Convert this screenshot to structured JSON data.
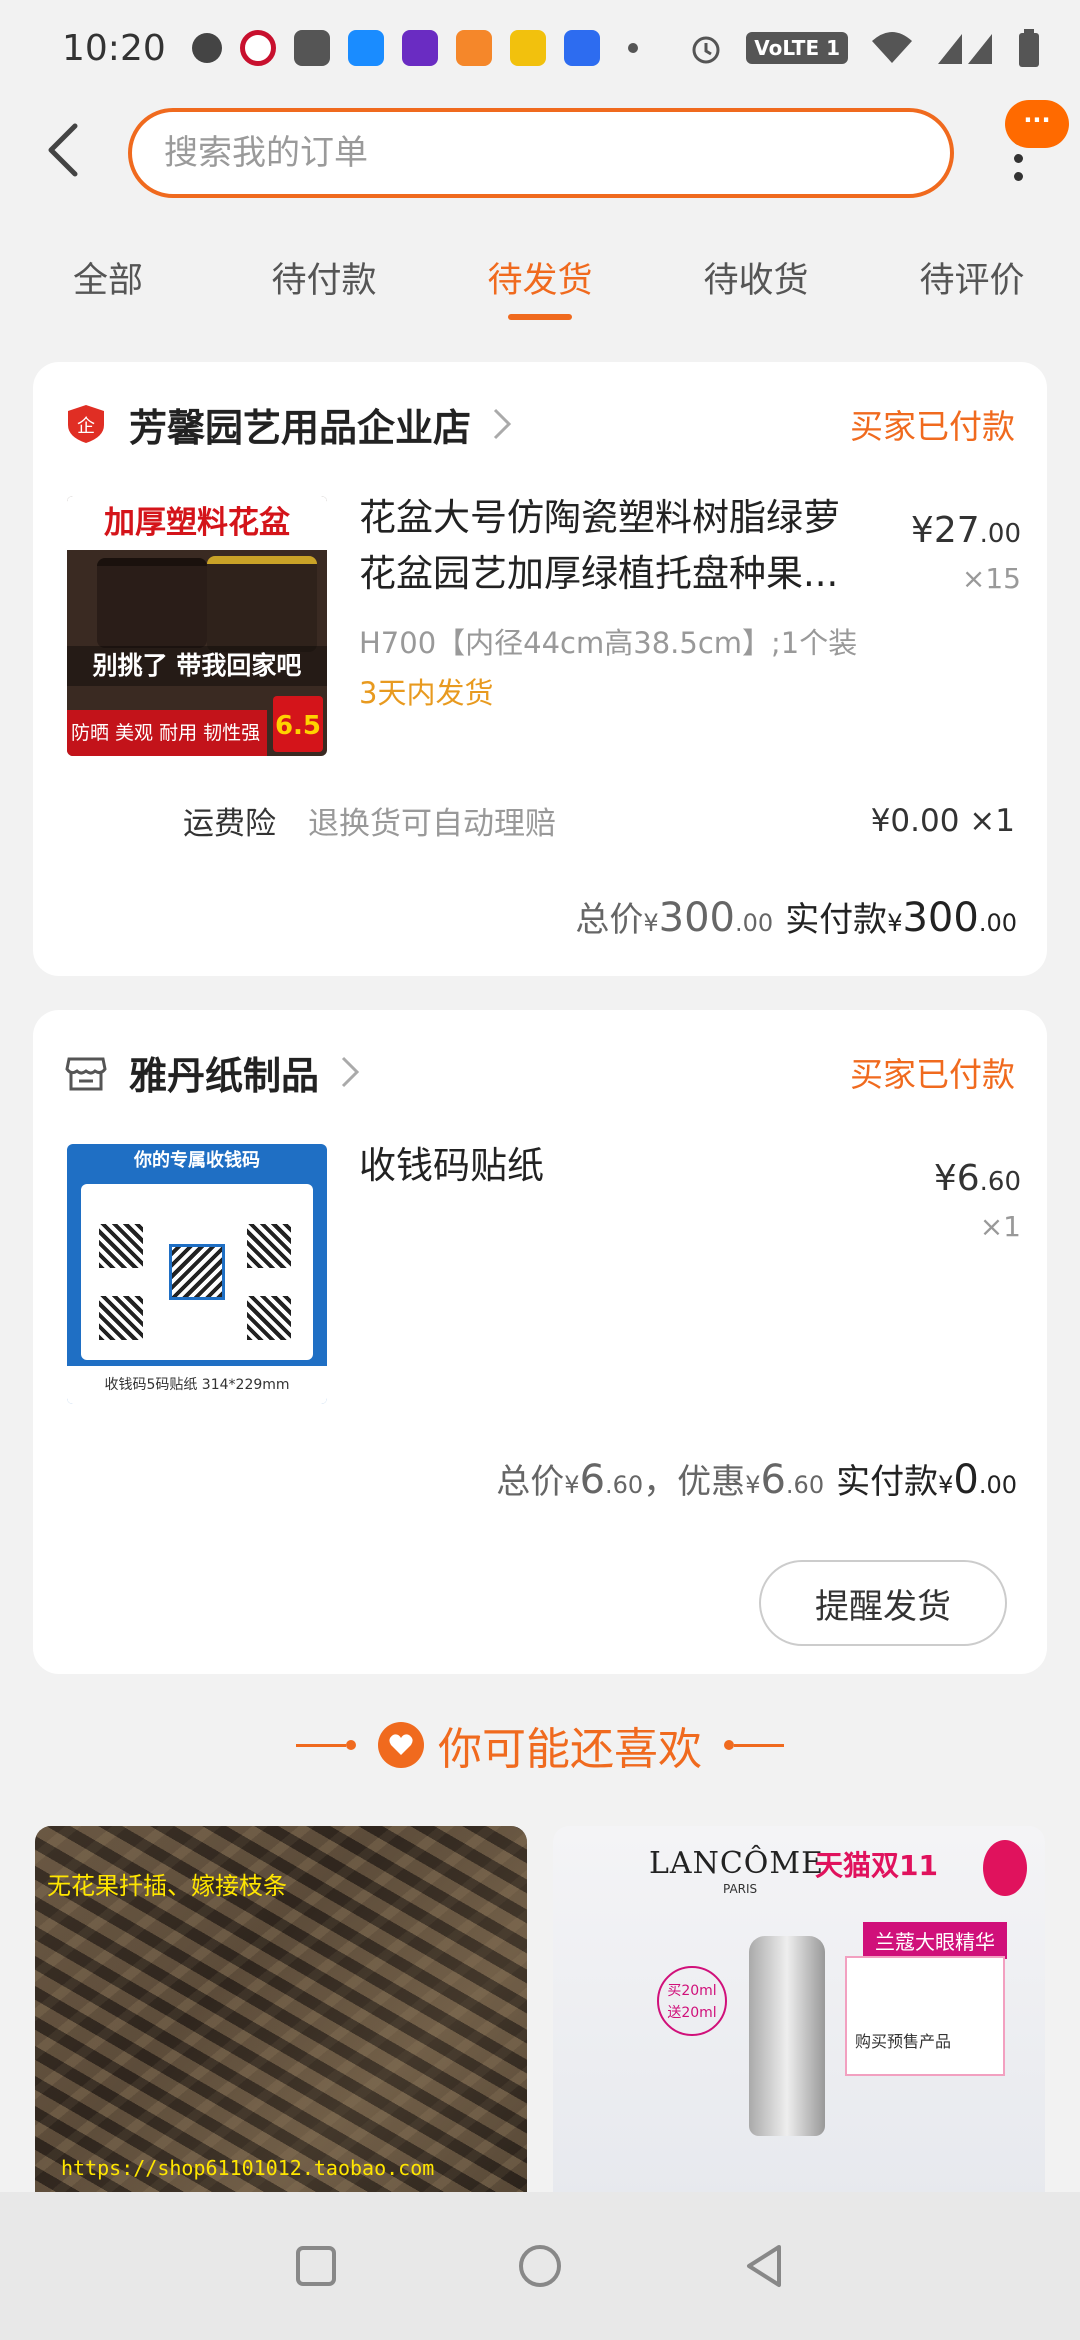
{
  "status_bar": {
    "time": "10:20",
    "network": "VoLTE 1",
    "icons": [
      "message-icon",
      "bank-icon",
      "mail-icon",
      "app-icon",
      "video-icon",
      "uc-icon",
      "weibo-icon",
      "baidu-icon",
      "dot-icon",
      "alarm-icon",
      "wifi-icon",
      "signal-icon",
      "battery-icon"
    ]
  },
  "header": {
    "search_placeholder": "搜索我的订单",
    "more_badge": "···"
  },
  "tabs": [
    {
      "label": "全部",
      "active": false
    },
    {
      "label": "待付款",
      "active": false
    },
    {
      "label": "待发货",
      "active": true
    },
    {
      "label": "待收货",
      "active": false
    },
    {
      "label": "待评价",
      "active": false
    }
  ],
  "orders": [
    {
      "shop_name": "芳馨园艺用品企业店",
      "status": "买家已付款",
      "thumb_text_top": "加厚塑料花盆",
      "thumb_text_mid": "别挑了 带我回家吧",
      "thumb_text_bottom": "防晒 美观 耐用 韧性强",
      "thumb_badge": "6.5",
      "product_title_line1": "花盆大号仿陶瓷塑料树脂绿萝",
      "product_title_line2": "花盆园艺加厚绿植托盘种果...",
      "spec": "H700【内径44cm高38.5cm】;1个装",
      "ship_note": "3天内发货",
      "price_int": "¥27",
      "price_dec": ".00",
      "qty": "×15",
      "insurance_label": "运费险",
      "insurance_desc": "退换货可自动理赔",
      "insurance_price": "¥0.00 ×1",
      "total_label": "总价",
      "total_cur": "¥",
      "total_int": "300",
      "total_dec": ".00",
      "paid_label": "实付款",
      "paid_cur": "¥",
      "paid_int": "300",
      "paid_dec": ".00"
    },
    {
      "shop_name": "雅丹纸制品",
      "status": "买家已付款",
      "thumb_text_top": "你的专属收钱码",
      "thumb_text_bottom": "收钱码5码贴纸 314*229mm",
      "product_title": "收钱码贴纸",
      "price_int": "¥6",
      "price_dec": ".60",
      "qty": "×1",
      "total_label": "总价",
      "total_cur": "¥",
      "total_int": "6",
      "total_dec": ".60",
      "discount_label": "，优惠",
      "discount_cur": "¥",
      "discount_int": "6",
      "discount_dec": ".60",
      "paid_label": "实付款",
      "paid_cur": "¥",
      "paid_int": "0",
      "paid_dec": ".00",
      "remind_button": "提醒发货"
    }
  ],
  "recommend": {
    "title": "你可能还喜欢",
    "items": [
      {
        "caption": "无花果扦插、嫁接枝条",
        "url_text": "https://shop61101012.taobao.com"
      },
      {
        "brand": "LANCÔME",
        "brand_sub": "PARIS",
        "event": "天猫双11",
        "tag": "兰蔻大眼精华",
        "offer": "买20ml 送20ml",
        "presale": "购买预售产品"
      }
    ]
  },
  "colors": {
    "accent": "#f06a1e",
    "ship_note": "#e89a1f",
    "muted": "#999999"
  }
}
